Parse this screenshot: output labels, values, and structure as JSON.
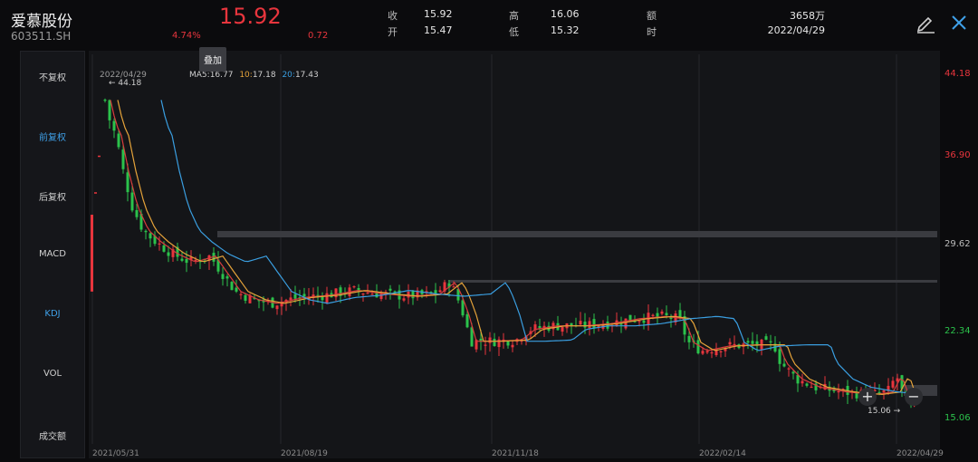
{
  "stock": {
    "name": "爱慕股份",
    "code": "603511.SH",
    "price": "15.92",
    "pct": "4.74%",
    "change": "0.72"
  },
  "quote": {
    "close_label": "收",
    "close": "15.92",
    "open_label": "开",
    "open": "15.47",
    "high_label": "高",
    "high": "16.06",
    "low_label": "低",
    "low": "15.32",
    "amount_label": "额",
    "amount": "3658万",
    "time_label": "时",
    "time": "2022/04/29"
  },
  "sidebar": {
    "items": [
      {
        "label": "不复权"
      },
      {
        "label": "前复权"
      },
      {
        "label": "后复权"
      },
      {
        "label": "MACD"
      },
      {
        "label": "KDJ"
      },
      {
        "label": "VOL"
      },
      {
        "label": "成交额"
      }
    ]
  },
  "chart": {
    "top_date": "2022/04/29",
    "legend": {
      "ma5_label": "MA5:",
      "ma5": "16.77",
      "ma10_label": "10:",
      "ma10": "17.18",
      "ma20_label": "20:",
      "ma20": "17.43"
    },
    "tooltip": "叠加",
    "right_axis": [
      "44.18",
      "36.90",
      "29.62",
      "22.34",
      "15.06"
    ],
    "bottom_axis": [
      "2021/05/31",
      "2021/08/19",
      "2021/11/18",
      "2022/02/14",
      "2022/04/29"
    ],
    "high_marker": "← 44.18",
    "low_marker": "15.06 →"
  },
  "chart_data": {
    "type": "candlestick",
    "ylim": [
      15.06,
      44.18
    ],
    "y_ticks": [
      44.18,
      36.9,
      29.62,
      22.34,
      15.06
    ],
    "x_ticks": [
      "2021/05/31",
      "2021/08/19",
      "2021/11/18",
      "2022/02/14",
      "2022/04/29"
    ],
    "ma_latest": {
      "MA5": 16.77,
      "MA10": 17.18,
      "MA20": 17.43
    },
    "series_colors": {
      "up": "#e8353d",
      "down": "#2bc24b",
      "ma5": "#d63d3d",
      "ma10": "#e5a33a",
      "ma20": "#3a9ee0"
    },
    "max_marker": 44.18,
    "min_marker": 15.06
  },
  "colors": {
    "up": "#e8353d",
    "down": "#2bc24b",
    "accent": "#3fa0e8",
    "bg": "#0b0b0d"
  },
  "icons": {
    "edit": "pencil-icon",
    "close": "close-icon",
    "zoom_in": "zoom-in-icon",
    "zoom_out": "zoom-out-icon"
  }
}
